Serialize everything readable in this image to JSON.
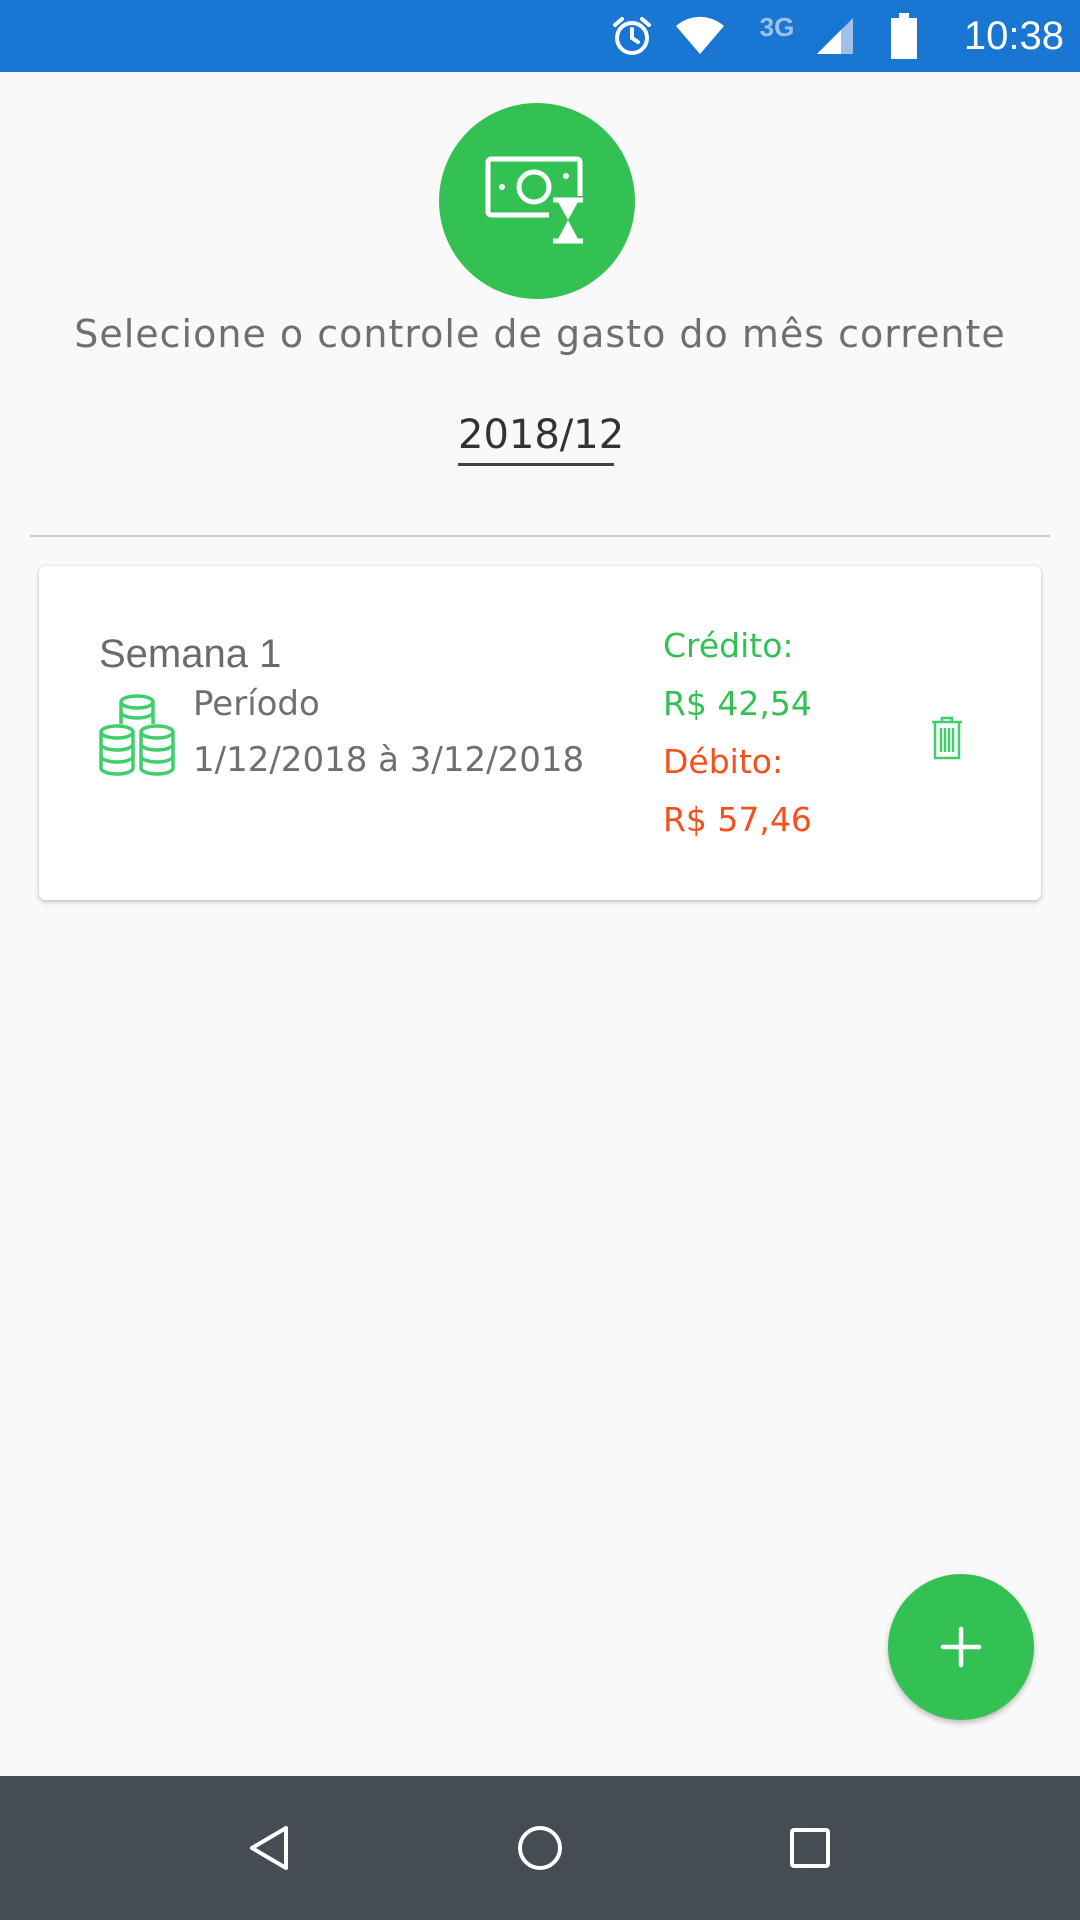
{
  "status_bar": {
    "time": "10:38",
    "network": "3G",
    "icons": [
      "alarm-icon",
      "wifi-icon",
      "signal-icon",
      "battery-icon"
    ],
    "background_color": "#1976d2"
  },
  "header": {
    "icon": "money-hourglass-icon",
    "subtitle": "Selecione o controle de gasto do mês corrente",
    "month": "2018/12",
    "accent_color": "#34c153"
  },
  "weeks": [
    {
      "title": "Semana 1",
      "icon": "coins-icon",
      "period_label": "Período",
      "period_value": "1/12/2018 à 3/12/2018",
      "credit_label": "Crédito:",
      "credit_value": "R$ 42,54",
      "debit_label": "Débito:",
      "debit_value": "R$ 57,46",
      "credit_color": "#34c153",
      "debit_color": "#f4511e"
    }
  ],
  "fab": {
    "icon": "plus-icon"
  },
  "nav_bar": {
    "icons": [
      "back-icon",
      "home-icon",
      "recents-icon"
    ]
  }
}
